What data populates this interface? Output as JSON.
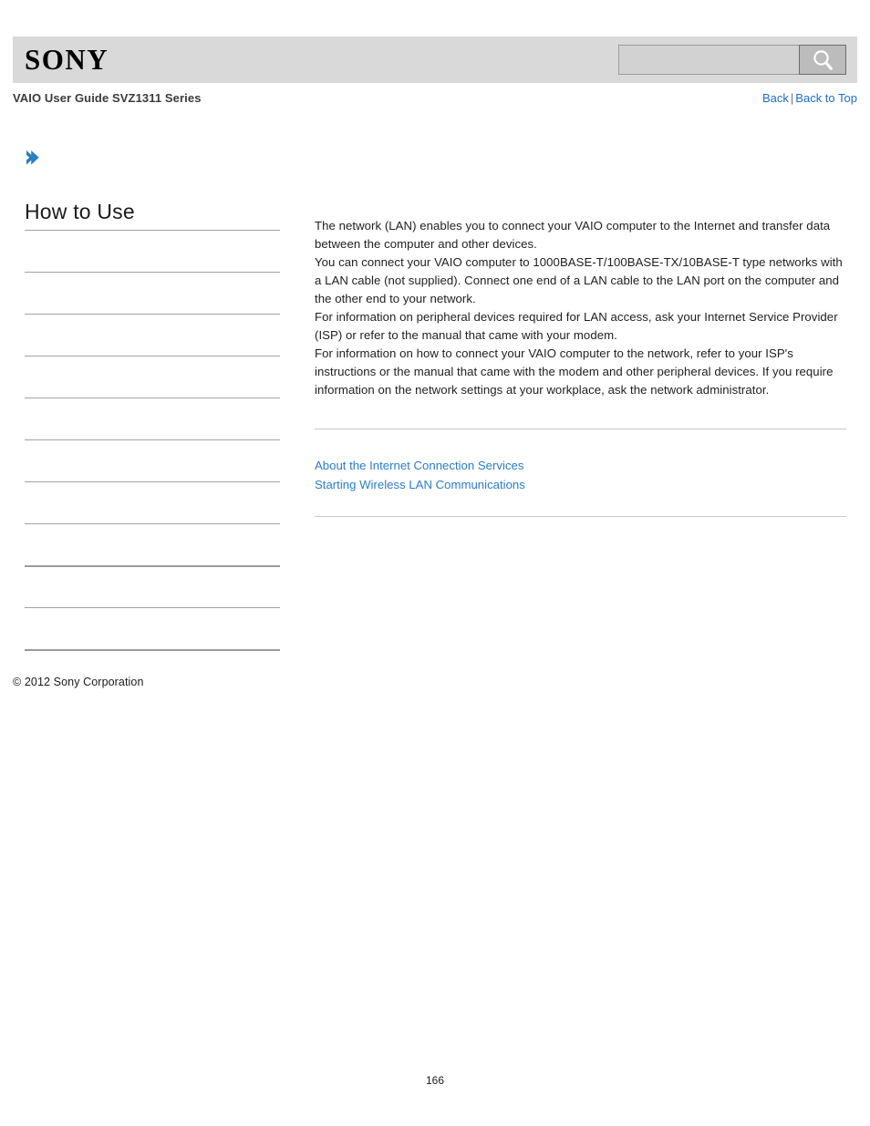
{
  "header": {
    "logo_text": "SONY",
    "search": {
      "value": "",
      "placeholder": "",
      "icon": "search-icon"
    }
  },
  "title_row": {
    "guide_title": "VAIO User Guide SVZ1311 Series",
    "back_label": "Back",
    "separator": "|",
    "back_to_top_label": "Back to Top"
  },
  "breadcrumb": {
    "arrow_icon": "chevron-right-icon"
  },
  "sidebar": {
    "heading": "How to Use",
    "items": [
      {
        "label": "",
        "rule": "thin"
      },
      {
        "label": "",
        "rule": "thin"
      },
      {
        "label": "",
        "rule": "thin"
      },
      {
        "label": "",
        "rule": "thin"
      },
      {
        "label": "",
        "rule": "thin"
      },
      {
        "label": "",
        "rule": "thin"
      },
      {
        "label": "",
        "rule": "thin"
      },
      {
        "label": "",
        "rule": "thin"
      },
      {
        "label": "",
        "rule": "thick"
      },
      {
        "label": "",
        "rule": "thin"
      },
      {
        "label": "",
        "rule": "thick"
      }
    ]
  },
  "main": {
    "paragraphs": [
      "The network (LAN) enables you to connect your VAIO computer to the Internet and transfer data between the computer and other devices.",
      "You can connect your VAIO computer to 1000BASE-T/100BASE-TX/10BASE-T type networks with a LAN cable (not supplied). Connect one end of a LAN cable to the LAN port on the computer and the other end to your network.",
      "For information on peripheral devices required for LAN access, ask your Internet Service Provider (ISP) or refer to the manual that came with your modem.",
      "For information on how to connect your VAIO computer to the network, refer to your ISP's instructions or the manual that came with the modem and other peripheral devices. If you require information on the network settings at your workplace, ask the network administrator."
    ],
    "related_links": [
      "About the Internet Connection Services",
      "Starting Wireless LAN Communications"
    ]
  },
  "footer": {
    "copyright": "© 2012 Sony Corporation",
    "page_number": "166"
  },
  "colors": {
    "header_bg": "#d9d9d9",
    "link_blue": "#2b7ec9",
    "nav_link_blue": "#1f6fc4",
    "arrow_blue": "#2a7fc0",
    "rule_gray": "#a3a3a3",
    "content_rule": "#c9c9c9"
  }
}
